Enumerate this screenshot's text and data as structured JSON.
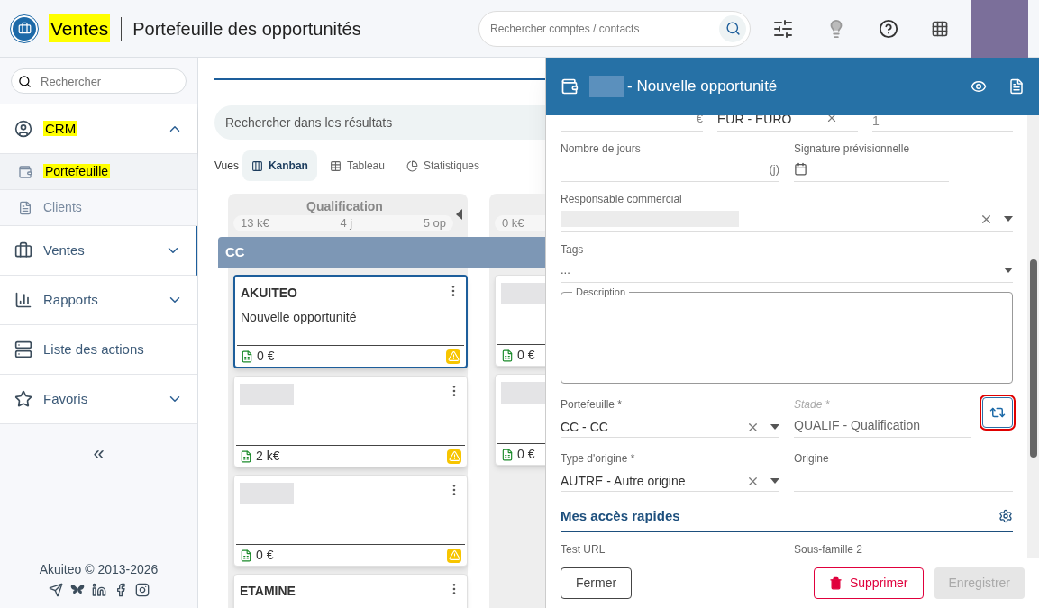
{
  "header": {
    "app": "Ventes",
    "app_highlighted": true,
    "title": "Portefeuille des opportunités",
    "search": {
      "placeholder": "Rechercher comptes / contacts"
    }
  },
  "sidebar": {
    "search": {
      "placeholder": "Rechercher"
    },
    "items": [
      {
        "label": "CRM",
        "kind": "group",
        "expanded": true,
        "selected": false,
        "highlighted": true,
        "children": [
          {
            "label": "Portefeuille",
            "selected": true,
            "highlighted": true
          },
          {
            "label": "Clients",
            "selected": false,
            "highlighted": false
          }
        ]
      },
      {
        "label": "Ventes",
        "kind": "group",
        "expanded": false,
        "selected": true,
        "highlighted": false
      },
      {
        "label": "Rapports",
        "kind": "group",
        "expanded": false,
        "selected": false,
        "highlighted": false
      },
      {
        "label": "Liste des actions",
        "kind": "link",
        "selected": false,
        "highlighted": false
      },
      {
        "label": "Favoris",
        "kind": "group",
        "expanded": false,
        "selected": false,
        "highlighted": false
      }
    ],
    "collapse": "«",
    "footer": "Akuiteo © 2013-2026"
  },
  "main": {
    "results_search": {
      "placeholder": "Rechercher dans les résultats"
    },
    "views_label": "Vues",
    "views": [
      {
        "label": "Kanban",
        "selected": true
      },
      {
        "label": "Tableau",
        "selected": false
      },
      {
        "label": "Statistiques",
        "selected": false
      }
    ],
    "group": "CC",
    "columns": [
      {
        "title": "Qualification",
        "stats": [
          "13 k€",
          "4 j",
          "5 op"
        ],
        "cards": [
          {
            "title": "AKUITEO",
            "subtitle": "Nouvelle opportunité",
            "amount": "0 €",
            "selected": true,
            "warning": true
          },
          {
            "amount": "2 k€",
            "selected": false,
            "warning": true
          },
          {
            "amount": "0 €",
            "selected": false,
            "warning": true
          },
          {
            "title": "ETAMINE",
            "selected": false
          }
        ]
      },
      {
        "stats": [
          "0 k€"
        ],
        "cards": [
          {
            "amount": "0 €",
            "selected": false
          },
          {
            "amount": "0 €",
            "selected": false
          }
        ]
      }
    ]
  },
  "drawer": {
    "title": "- Nouvelle opportunité",
    "currency_row": {
      "suffix": "€",
      "currency": "EUR - EURO",
      "rate": "1"
    },
    "rows": [
      [
        {
          "kind": "number",
          "label": "Nombre de jours",
          "suffix": "(j)"
        },
        {
          "kind": "date",
          "label": "Signature prévisionnelle"
        }
      ],
      [
        {
          "kind": "select",
          "label": "Responsable commercial",
          "redacted": true,
          "clearable": true
        }
      ],
      [
        {
          "kind": "tags",
          "label": "Tags",
          "value": "..."
        }
      ],
      [
        {
          "kind": "textarea",
          "label": "Description"
        }
      ],
      [
        {
          "kind": "select",
          "label": "Portefeuille *",
          "value": "CC - CC",
          "clearable": true
        },
        {
          "kind": "stage",
          "label": "Stade *",
          "value": "QUALIF - Qualification",
          "disabled": true,
          "highlighted": true
        }
      ],
      [
        {
          "kind": "select",
          "label": "Type d'origine *",
          "value": "AUTRE - Autre origine",
          "clearable": true
        },
        {
          "kind": "text",
          "label": "Origine"
        }
      ]
    ],
    "section": "Mes accès rapides",
    "cut_labels": [
      "Test URL",
      "Sous-famille 2"
    ],
    "buttons": [
      {
        "label": "Fermer",
        "kind": "secondary",
        "disabled": false
      },
      {
        "label": "Supprimer",
        "kind": "danger",
        "disabled": false
      },
      {
        "label": "Enregistrer",
        "kind": "primary",
        "disabled": true
      }
    ]
  }
}
